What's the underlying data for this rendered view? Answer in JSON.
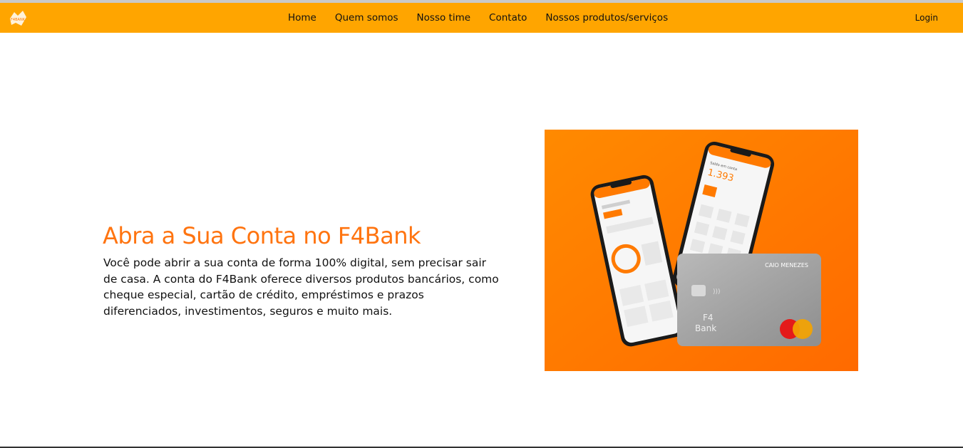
{
  "brand": {
    "logo_text": "F4BANK",
    "accent_color": "#ffa500",
    "title_color": "#ff7410"
  },
  "nav": {
    "items": [
      {
        "label": "Home"
      },
      {
        "label": "Quem somos"
      },
      {
        "label": "Nosso time"
      },
      {
        "label": "Contato"
      },
      {
        "label": "Nossos produtos/serviços"
      }
    ],
    "login_label": "Login"
  },
  "hero": {
    "title": "Abra a Sua Conta no F4Bank",
    "description": "Você pode abrir a sua conta de forma 100% digital, sem precisar sair de casa. A conta do F4Bank oferece diversos produtos bancários, como cheque especial, cartão de crédito, empréstimos e prazos diferenciados, investimentos, seguros e muito mais."
  },
  "illustration": {
    "balance_label": "Saldo em conta",
    "balance_value": "1.393",
    "card_holder": "CAIO MENEZES",
    "card_brand_line1": "F4",
    "card_brand_line2": "Bank",
    "background_color": "#ff7a00"
  }
}
